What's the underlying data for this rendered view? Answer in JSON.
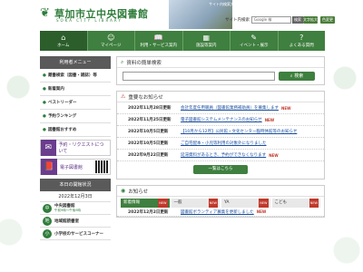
{
  "header": {
    "logo_title": "草加市立中央図書館",
    "logo_sub": "SOKA CITY LIBRARY",
    "top_links": [
      "サイト内検索方法"
    ],
    "search_label": "サイト内検索",
    "search_placeholder": "Google 検",
    "search_go": "検索",
    "font_tools": [
      "文字拡大",
      "色変更"
    ]
  },
  "nav": {
    "items": [
      {
        "icon": "⌂",
        "label": "ホーム"
      },
      {
        "icon": "☺",
        "label": "マイページ"
      },
      {
        "icon": "📖",
        "label": "利用・サービス案内"
      },
      {
        "icon": "▦",
        "label": "施設等案内"
      },
      {
        "icon": "✎",
        "label": "イベント・展示"
      },
      {
        "icon": "?",
        "label": "よくある質問"
      }
    ]
  },
  "sidebar": {
    "menu_head": "利用者メニュー",
    "items": [
      {
        "label": "蔵書検索（図書・雑誌）等"
      },
      {
        "label": "新着案内"
      },
      {
        "label": "ベストリーダー"
      },
      {
        "label": "予約ランキング"
      },
      {
        "label": "図書館おすすめ"
      }
    ],
    "banners": [
      {
        "icon": "✉",
        "label": "予約・リクエストにつ いて"
      },
      {
        "icon": "📕",
        "label": "電子図書館"
      }
    ],
    "today_head": "本日の開館状況",
    "today_date": "2022年12月3日",
    "libraries": [
      {
        "icon": "中",
        "name": "中央図書館",
        "hours": "午前9時～午後9時"
      },
      {
        "icon": "地",
        "name": "地域館読書室"
      },
      {
        "icon": "小",
        "name": "小学校のサービスコーナー"
      }
    ]
  },
  "simple_search": {
    "title": "資料の簡単検索",
    "button": "検索"
  },
  "notices": {
    "title": "重要なお知らせ",
    "items": [
      {
        "date": "2022年11月28日更新",
        "text": "会計年度任用職員（図書館業務補助員）を募集します",
        "new": "NEW"
      },
      {
        "date": "2022年11月25日更新",
        "text": "電子図書館システムメンテナンスのお知らせ",
        "new": "NEW"
      },
      {
        "date": "2022年10月5日更新",
        "text": "【10月から12月】公民館・文化センター臨時休館等のお知らせ",
        "new": ""
      },
      {
        "date": "2022年10月5日更新",
        "text": "ご自宅配本・小児等利用の対象外になりました",
        "new": ""
      },
      {
        "date": "2022年9月22日更新",
        "text": "延滞資料があるとき、予約ができなくなります",
        "new": "NEW"
      }
    ],
    "list_button": "一覧はこちら"
  },
  "news": {
    "title": "お知らせ",
    "tabs": [
      {
        "label": "新着情報",
        "badge": "NEW"
      },
      {
        "label": "一般",
        "badge": "NEW"
      },
      {
        "label": "YA",
        "badge": "NEW"
      },
      {
        "label": "こども",
        "badge": "NEW"
      }
    ],
    "items": [
      {
        "date": "2022年12月2日更新",
        "text": "図書館ボランティア募集を更新しました",
        "new": "NEW"
      }
    ]
  }
}
